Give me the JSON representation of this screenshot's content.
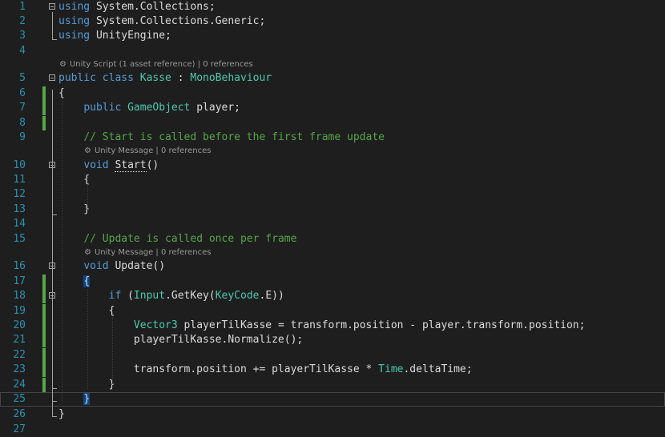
{
  "editor": {
    "lines": [
      {
        "n": "1",
        "tokens": [
          [
            "kw",
            "using"
          ],
          [
            "nm",
            " System.Collections;"
          ]
        ]
      },
      {
        "n": "2",
        "tokens": [
          [
            "kw",
            "using"
          ],
          [
            "nm",
            " System.Collections.Generic;"
          ]
        ]
      },
      {
        "n": "3",
        "tokens": [
          [
            "kw",
            "using"
          ],
          [
            "nm",
            " UnityEngine;"
          ]
        ]
      },
      {
        "n": "4",
        "tokens": []
      },
      {
        "n": "5",
        "tokens": [
          [
            "kw",
            "public class "
          ],
          [
            "ty",
            "Kasse"
          ],
          [
            "nm",
            " : "
          ],
          [
            "ty",
            "MonoBehaviour"
          ]
        ]
      },
      {
        "n": "6",
        "tokens": [
          [
            "nm",
            "{"
          ]
        ]
      },
      {
        "n": "7",
        "tokens": [
          [
            "nm",
            "    "
          ],
          [
            "kw",
            "public "
          ],
          [
            "ty",
            "GameObject"
          ],
          [
            "nm",
            " player;"
          ]
        ]
      },
      {
        "n": "8",
        "tokens": []
      },
      {
        "n": "9",
        "tokens": [
          [
            "nm",
            "    "
          ],
          [
            "cm",
            "// Start is called before the first frame update"
          ]
        ]
      },
      {
        "n": "10",
        "tokens": [
          [
            "nm",
            "    "
          ],
          [
            "kw",
            "void "
          ],
          [
            "fn",
            "Start"
          ],
          [
            "nm",
            "()"
          ]
        ]
      },
      {
        "n": "11",
        "tokens": [
          [
            "nm",
            "    {"
          ]
        ]
      },
      {
        "n": "12",
        "tokens": []
      },
      {
        "n": "13",
        "tokens": [
          [
            "nm",
            "    }"
          ]
        ]
      },
      {
        "n": "14",
        "tokens": []
      },
      {
        "n": "15",
        "tokens": [
          [
            "nm",
            "    "
          ],
          [
            "cm",
            "// Update is called once per frame"
          ]
        ]
      },
      {
        "n": "16",
        "tokens": [
          [
            "nm",
            "    "
          ],
          [
            "kw",
            "void "
          ],
          [
            "fn",
            "Update"
          ],
          [
            "nm",
            "()"
          ]
        ]
      },
      {
        "n": "17",
        "tokens": [
          [
            "nm",
            "    "
          ],
          [
            "hl",
            "{"
          ]
        ]
      },
      {
        "n": "18",
        "tokens": [
          [
            "nm",
            "        "
          ],
          [
            "kw",
            "if "
          ],
          [
            "nm",
            "("
          ],
          [
            "ty",
            "Input"
          ],
          [
            "nm",
            ".GetKey("
          ],
          [
            "ty",
            "KeyCode"
          ],
          [
            "nm",
            ".E))"
          ]
        ]
      },
      {
        "n": "19",
        "tokens": [
          [
            "nm",
            "        {"
          ]
        ]
      },
      {
        "n": "20",
        "tokens": [
          [
            "nm",
            "            "
          ],
          [
            "ty",
            "Vector3"
          ],
          [
            "nm",
            " playerTilKasse = transform.position - player.transform.position;"
          ]
        ]
      },
      {
        "n": "21",
        "tokens": [
          [
            "nm",
            "            playerTilKasse.Normalize();"
          ]
        ]
      },
      {
        "n": "22",
        "tokens": []
      },
      {
        "n": "23",
        "tokens": [
          [
            "nm",
            "            transform.position += playerTilKasse * "
          ],
          [
            "ty",
            "Time"
          ],
          [
            "nm",
            ".deltaTime;"
          ]
        ]
      },
      {
        "n": "24",
        "tokens": [
          [
            "nm",
            "        }"
          ]
        ]
      },
      {
        "n": "25",
        "tokens": [
          [
            "nm",
            "    "
          ],
          [
            "hl",
            "}"
          ]
        ]
      },
      {
        "n": "26",
        "tokens": [
          [
            "nm",
            "}"
          ]
        ]
      },
      {
        "n": "27",
        "tokens": []
      }
    ],
    "codelens": {
      "class_lens": {
        "icon": "unity-gear-icon",
        "glyph": "⚙",
        "text": "Unity Script (1 asset reference) | 0 references"
      },
      "start_lens": {
        "icon": "unity-gear-icon",
        "glyph": "⚙",
        "text": "Unity Message | 0 references"
      },
      "update_lens": {
        "icon": "unity-gear-icon",
        "glyph": "⚙",
        "text": "Unity Message | 0 references"
      }
    },
    "colors": {
      "background": "#1e1e1e",
      "line_number": "#2b91af",
      "keyword": "#569cd6",
      "type": "#4ec9b0",
      "comment": "#57a64a",
      "text": "#dcdcdc",
      "change_marker": "#57a64a"
    }
  }
}
